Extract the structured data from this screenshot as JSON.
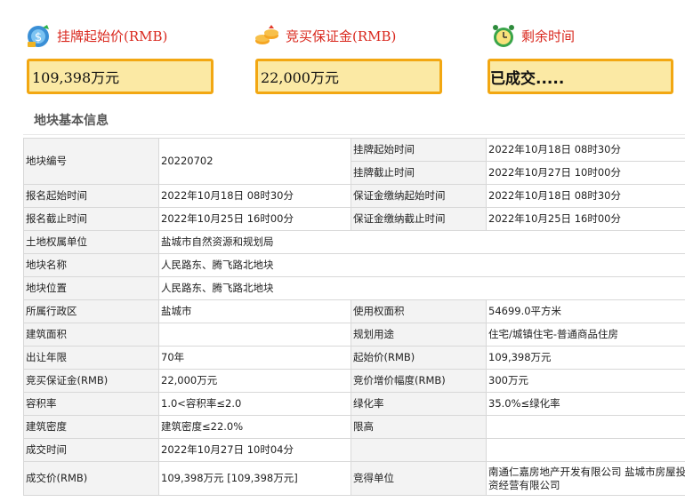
{
  "panels": {
    "start_price": {
      "title": "挂牌起始价(RMB)",
      "value": "109,398万元"
    },
    "deposit": {
      "title": "竞买保证金(RMB)",
      "value": "22,000万元"
    },
    "remaining": {
      "title": "剩余时间",
      "value": "已成交....."
    }
  },
  "section_title": "地块基本信息",
  "table": {
    "parcel_no_label": "地块编号",
    "parcel_no": "20220702",
    "list_start_label": "挂牌起始时间",
    "list_start": "2022年10月18日 08时30分",
    "list_end_label": "挂牌截止时间",
    "list_end": "2022年10月27日 10时00分",
    "reg_start_label": "报名起始时间",
    "reg_start": "2022年10月18日 08时30分",
    "dep_start_label": "保证金缴纳起始时间",
    "dep_start": "2022年10月18日 08时30分",
    "reg_end_label": "报名截止时间",
    "reg_end": "2022年10月25日 16时00分",
    "dep_end_label": "保证金缴纳截止时间",
    "dep_end": "2022年10月25日 16时00分",
    "owner_label": "土地权属单位",
    "owner": "盐城市自然资源和规划局",
    "name_label": "地块名称",
    "name": "人民路东、腾飞路北地块",
    "location_label": "地块位置",
    "location": "人民路东、腾飞路北地块",
    "district_label": "所属行政区",
    "district": "盐城市",
    "use_area_label": "使用权面积",
    "use_area": "54699.0平方米",
    "build_area_label": "建筑面积",
    "build_area": "",
    "planned_use_label": "规划用途",
    "planned_use": "住宅/城镇住宅-普通商品住房",
    "term_label": "出让年限",
    "term": "70年",
    "start_price_label": "起始价(RMB)",
    "start_price": "109,398万元",
    "deposit_label": "竞买保证金(RMB)",
    "deposit": "22,000万元",
    "increment_label": "竞价增价幅度(RMB)",
    "increment": "300万元",
    "far_label": "容积率",
    "far": "1.0<容积率≤2.0",
    "green_label": "绿化率",
    "green": "35.0%≤绿化率",
    "density_label": "建筑密度",
    "density": "建筑密度≤22.0%",
    "height_label": "限高",
    "height": "",
    "deal_time_label": "成交时间",
    "deal_time": "2022年10月27日 10时04分",
    "deal_price_label": "成交价(RMB)",
    "deal_price": "109,398万元 [109,398万元]",
    "winner_label": "竞得单位",
    "winner": "南通仁嘉房地产开发有限公司 盐城市房屋投资经营有限公司"
  },
  "icons": {
    "price": "money-bag-icon",
    "deposit": "coins-icon",
    "time": "alarm-clock-icon"
  },
  "colors": {
    "panel_title": "#d9281e",
    "box_fill": "#fbe9a4",
    "box_border": "#f2a712"
  }
}
